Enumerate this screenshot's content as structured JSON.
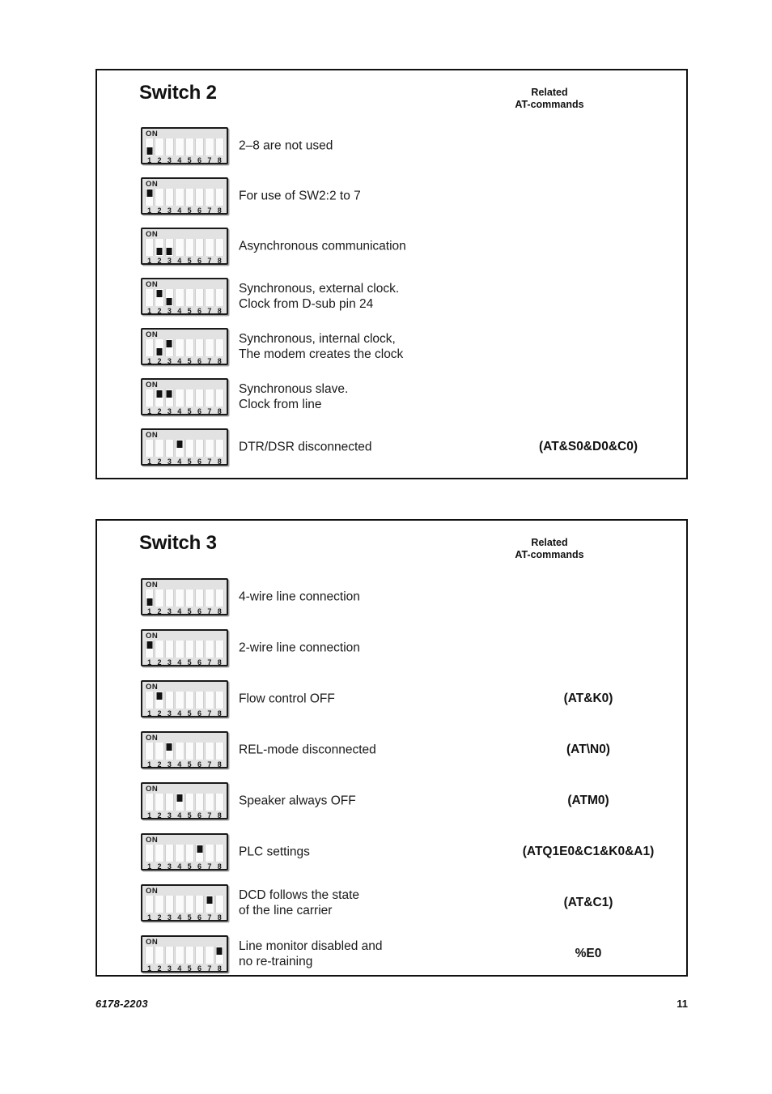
{
  "footer": {
    "document_number": "6178-2203",
    "page_number": "11"
  },
  "sections": [
    {
      "title": "Switch 2",
      "header_note_line1": "Related",
      "header_note_line2": "AT-commands",
      "rows": [
        {
          "description": "2–8 are not used",
          "command": "",
          "switches": [
            "down",
            "none",
            "none",
            "none",
            "none",
            "none",
            "none",
            "none"
          ]
        },
        {
          "description": "For use of SW2:2 to 7",
          "command": "",
          "switches": [
            "up",
            "none",
            "none",
            "none",
            "none",
            "none",
            "none",
            "none"
          ]
        },
        {
          "description": "Asynchronous communication",
          "command": "",
          "switches": [
            "none",
            "down",
            "down",
            "none",
            "none",
            "none",
            "none",
            "none"
          ]
        },
        {
          "description": "Synchronous, external clock.\nClock from D-sub pin 24",
          "command": "",
          "switches": [
            "none",
            "up",
            "down",
            "none",
            "none",
            "none",
            "none",
            "none"
          ]
        },
        {
          "description": "Synchronous, internal clock,\nThe modem creates the clock",
          "command": "",
          "switches": [
            "none",
            "down",
            "up",
            "none",
            "none",
            "none",
            "none",
            "none"
          ]
        },
        {
          "description": "Synchronous slave.\nClock from line",
          "command": "",
          "switches": [
            "none",
            "up",
            "up",
            "none",
            "none",
            "none",
            "none",
            "none"
          ]
        },
        {
          "description": "DTR/DSR disconnected",
          "command": "(AT&S0&D0&C0)",
          "switches": [
            "none",
            "none",
            "none",
            "up",
            "none",
            "none",
            "none",
            "none"
          ]
        }
      ]
    },
    {
      "title": "Switch 3",
      "header_note_line1": "Related",
      "header_note_line2": "AT-commands",
      "rows": [
        {
          "description": "4-wire line connection",
          "command": "",
          "switches": [
            "down",
            "none",
            "none",
            "none",
            "none",
            "none",
            "none",
            "none"
          ]
        },
        {
          "description": "2-wire line connection",
          "command": "",
          "switches": [
            "up",
            "none",
            "none",
            "none",
            "none",
            "none",
            "none",
            "none"
          ]
        },
        {
          "description": "Flow control OFF",
          "command": "(AT&K0)",
          "switches": [
            "none",
            "up",
            "none",
            "none",
            "none",
            "none",
            "none",
            "none"
          ]
        },
        {
          "description": "REL-mode disconnected",
          "command": "(AT\\N0)",
          "switches": [
            "none",
            "none",
            "up",
            "none",
            "none",
            "none",
            "none",
            "none"
          ]
        },
        {
          "description": "Speaker always OFF",
          "command": "(ATM0)",
          "switches": [
            "none",
            "none",
            "none",
            "up",
            "none",
            "none",
            "none",
            "none"
          ]
        },
        {
          "description": "PLC settings",
          "command": "(ATQ1E0&C1&K0&A1)",
          "switches": [
            "none",
            "none",
            "none",
            "none",
            "none",
            "up",
            "none",
            "none"
          ]
        },
        {
          "description": "DCD follows the state\nof the line carrier",
          "command": "(AT&C1)",
          "switches": [
            "none",
            "none",
            "none",
            "none",
            "none",
            "none",
            "up",
            "none"
          ]
        },
        {
          "description": "Line monitor disabled and\nno re-training",
          "command": "%E0",
          "switches": [
            "none",
            "none",
            "none",
            "none",
            "none",
            "none",
            "none",
            "up"
          ]
        }
      ]
    }
  ],
  "dip": {
    "on_label": "ON",
    "numbers": [
      "1",
      "2",
      "3",
      "4",
      "5",
      "6",
      "7",
      "8"
    ]
  }
}
